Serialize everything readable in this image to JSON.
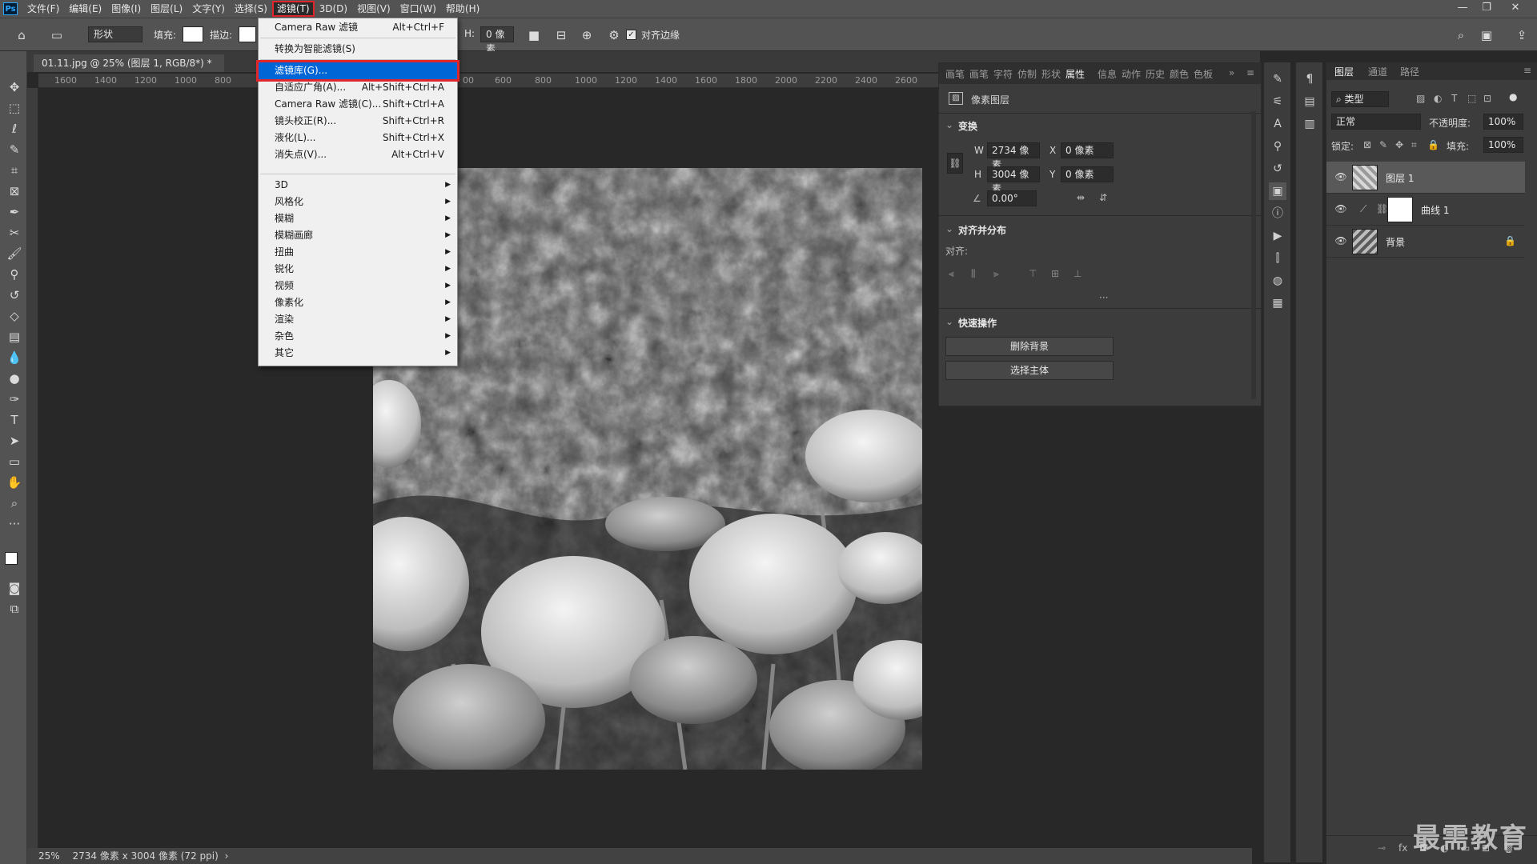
{
  "app": {
    "logo_text": "Ps"
  },
  "menubar": {
    "items": [
      "文件(F)",
      "编辑(E)",
      "图像(I)",
      "图层(L)",
      "文字(Y)",
      "选择(S)",
      "滤镜(T)",
      "3D(D)",
      "视图(V)",
      "窗口(W)",
      "帮助(H)"
    ],
    "active_index": 6
  },
  "window_controls": {
    "minimize": "—",
    "restore": "❐",
    "close": "✕"
  },
  "options_bar": {
    "shape_mode": "形状",
    "fill_label": "填充:",
    "stroke_label": "描边:",
    "h_label": "H:",
    "h_value": "0 像素",
    "align_edges_label": "对齐边缘",
    "align_edges_checked": true
  },
  "document": {
    "tab_title": "01.11.jpg @ 25% (图层 1, RGB/8*) *",
    "tab_close": "×",
    "ruler_left_ticks": [
      "1600",
      "1400",
      "1200",
      "1000",
      "800"
    ],
    "ruler_right_ticks": [
      "00",
      "600",
      "800",
      "1000",
      "1200",
      "1400",
      "1600",
      "1800",
      "2000",
      "2200",
      "2400",
      "2600"
    ]
  },
  "status_bar": {
    "zoom": "25%",
    "doc_info": "2734 像素 x 3004 像素 (72 ppi)",
    "more_arrow": "›"
  },
  "filter_menu": {
    "items": [
      {
        "label": "Camera Raw 滤镜",
        "shortcut": "Alt+Ctrl+F"
      },
      {
        "label": "转换为智能滤镜(S)",
        "shortcut": ""
      },
      {
        "label": "滤镜库(G)...",
        "shortcut": "",
        "highlighted": true
      },
      {
        "label": "自适应广角(A)...",
        "shortcut": "Alt+Shift+Ctrl+A"
      },
      {
        "label": "Camera Raw 滤镜(C)...",
        "shortcut": "Shift+Ctrl+A"
      },
      {
        "label": "镜头校正(R)...",
        "shortcut": "Shift+Ctrl+R"
      },
      {
        "label": "液化(L)...",
        "shortcut": "Shift+Ctrl+X"
      },
      {
        "label": "消失点(V)...",
        "shortcut": "Alt+Ctrl+V"
      }
    ],
    "submenus": [
      "3D",
      "风格化",
      "模糊",
      "模糊画廊",
      "扭曲",
      "锐化",
      "视频",
      "像素化",
      "渲染",
      "杂色",
      "其它"
    ],
    "submenu_arrow": "▶"
  },
  "properties_panel": {
    "tabs": [
      "画笔",
      "画笔",
      "字符",
      "仿制",
      "形状",
      "属性",
      "信息",
      "动作",
      "历史",
      "颜色",
      "色板"
    ],
    "active_tab_index": 5,
    "overflow": "»",
    "menu_icon": "≡",
    "layer_type": "像素图层",
    "transform_title": "变换",
    "w_label": "W",
    "w_value": "2734 像素",
    "x_label": "X",
    "x_value": "0 像素",
    "h_label": "H",
    "h_value": "3004 像素",
    "y_label": "Y",
    "y_value": "0 像素",
    "angle_value": "0.00°",
    "align_title": "对齐并分布",
    "align_label": "对齐:",
    "more": "···",
    "quick_title": "快速操作",
    "remove_bg_button": "删除背景",
    "select_subject_button": "选择主体"
  },
  "layers_panel": {
    "tabs": [
      "图层",
      "通道",
      "路径"
    ],
    "active_tab_index": 0,
    "menu_icon": "≡",
    "filter_kind": "类型",
    "blend_mode": "正常",
    "opacity_label": "不透明度:",
    "opacity_value": "100%",
    "lock_label": "锁定:",
    "fill_label": "填充:",
    "fill_value": "100%",
    "layers": [
      {
        "name": "图层 1",
        "selected": true,
        "visible": true,
        "kind": "pixel"
      },
      {
        "name": "曲线 1",
        "selected": false,
        "visible": true,
        "kind": "adjustment"
      },
      {
        "name": "背景",
        "selected": false,
        "visible": true,
        "kind": "background",
        "locked": true
      }
    ],
    "footer_icons": [
      "link-icon",
      "fx-icon",
      "mask-icon",
      "adjustment-icon",
      "folder-icon",
      "new-layer-icon",
      "trash-icon"
    ],
    "footer_glyphs": [
      "⊸",
      "fx",
      "◘",
      "◐",
      "▭",
      "⊞",
      "🗑"
    ]
  },
  "watermark": {
    "text": "最需教育"
  },
  "colors": {
    "menu_highlight": "#0066d6",
    "red_outline": "#e0262b",
    "panel_bg": "#3c3c3c",
    "bar_bg": "#535353"
  }
}
